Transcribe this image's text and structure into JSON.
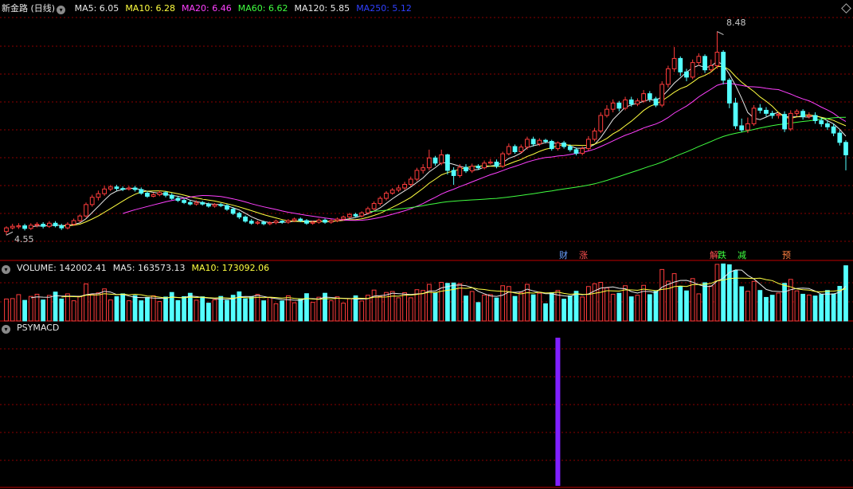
{
  "header": {
    "stock_name": "新金路 (日线)",
    "ma": [
      {
        "label": "MA5: 6.05",
        "color": "#e8e8e8"
      },
      {
        "label": "MA10: 6.28",
        "color": "#ffff40"
      },
      {
        "label": "MA20: 6.46",
        "color": "#ff40ff"
      },
      {
        "label": "MA60: 6.62",
        "color": "#40ff40"
      },
      {
        "label": "MA120: 5.85",
        "color": "#e8e8e8"
      },
      {
        "label": "MA250: 5.12",
        "color": "#3040ff"
      }
    ]
  },
  "volume_header": {
    "volume": "VOLUME: 142002.41",
    "ma5": "MA5: 163573.13",
    "ma10": "MA10: 173092.06"
  },
  "indicator_header": {
    "name": "PSYMACD"
  },
  "price_labels": {
    "high": "8.48",
    "low": "4.55"
  },
  "event_tags": [
    {
      "text": "财",
      "color": "#6aa0ff"
    },
    {
      "text": "涨",
      "color": "#ff5050"
    },
    {
      "text": "解",
      "color": "#ff5050"
    },
    {
      "text": "跌",
      "color": "#40ff40"
    },
    {
      "text": "减",
      "color": "#40ff40"
    },
    {
      "text": "预",
      "color": "#ff8040"
    }
  ],
  "colors": {
    "up": "#ff3c3c",
    "down": "#54ffff",
    "grid": "#8c0000",
    "separator": "#c00000",
    "psymacd": "#8020ff"
  },
  "chart_data": {
    "type": "candlestick",
    "title": "新金路 (日线)",
    "price_high": 8.48,
    "price_low": 4.55,
    "ylim": [
      4.4,
      8.75
    ],
    "candles": [
      [
        4.62,
        4.69,
        4.72,
        4.55
      ],
      [
        4.69,
        4.72,
        4.77,
        4.66
      ],
      [
        4.71,
        4.73,
        4.78,
        4.67
      ],
      [
        4.73,
        4.68,
        4.77,
        4.64
      ],
      [
        4.68,
        4.74,
        4.78,
        4.65
      ],
      [
        4.74,
        4.76,
        4.8,
        4.7
      ],
      [
        4.76,
        4.72,
        4.8,
        4.68
      ],
      [
        4.72,
        4.78,
        4.82,
        4.69
      ],
      [
        4.78,
        4.73,
        4.82,
        4.7
      ],
      [
        4.73,
        4.69,
        4.77,
        4.65
      ],
      [
        4.69,
        4.76,
        4.8,
        4.66
      ],
      [
        4.76,
        4.83,
        4.87,
        4.73
      ],
      [
        4.83,
        4.92,
        4.95,
        4.8
      ],
      [
        4.92,
        5.14,
        5.18,
        4.89
      ],
      [
        5.14,
        5.28,
        5.33,
        5.1
      ],
      [
        5.28,
        5.35,
        5.41,
        5.22
      ],
      [
        5.35,
        5.44,
        5.5,
        5.31
      ],
      [
        5.44,
        5.48,
        5.52,
        5.4
      ],
      [
        5.48,
        5.45,
        5.52,
        5.41
      ],
      [
        5.45,
        5.44,
        5.49,
        5.4
      ],
      [
        5.44,
        5.46,
        5.5,
        5.41
      ],
      [
        5.46,
        5.43,
        5.5,
        5.39
      ],
      [
        5.43,
        5.36,
        5.47,
        5.33
      ],
      [
        5.36,
        5.3,
        5.4,
        5.27
      ],
      [
        5.3,
        5.33,
        5.37,
        5.28
      ],
      [
        5.33,
        5.37,
        5.41,
        5.3
      ],
      [
        5.37,
        5.32,
        5.4,
        5.28
      ],
      [
        5.32,
        5.26,
        5.36,
        5.23
      ],
      [
        5.26,
        5.22,
        5.3,
        5.19
      ],
      [
        5.22,
        5.18,
        5.26,
        5.15
      ],
      [
        5.18,
        5.15,
        5.22,
        5.12
      ],
      [
        5.15,
        5.18,
        5.22,
        5.12
      ],
      [
        5.18,
        5.15,
        5.21,
        5.12
      ],
      [
        5.15,
        5.11,
        5.18,
        5.08
      ],
      [
        5.11,
        5.14,
        5.17,
        5.08
      ],
      [
        5.14,
        5.12,
        5.17,
        5.09
      ],
      [
        5.12,
        5.05,
        5.15,
        5.02
      ],
      [
        5.05,
        4.97,
        5.09,
        4.94
      ],
      [
        4.97,
        4.9,
        5.0,
        4.86
      ],
      [
        4.9,
        4.82,
        4.93,
        4.79
      ],
      [
        4.82,
        4.78,
        4.86,
        4.75
      ],
      [
        4.78,
        4.8,
        4.83,
        4.75
      ],
      [
        4.8,
        4.77,
        4.83,
        4.74
      ],
      [
        4.77,
        4.79,
        4.82,
        4.74
      ],
      [
        4.79,
        4.82,
        4.85,
        4.76
      ],
      [
        4.82,
        4.8,
        4.84,
        4.77
      ],
      [
        4.8,
        4.83,
        4.86,
        4.77
      ],
      [
        4.83,
        4.86,
        4.89,
        4.8
      ],
      [
        4.86,
        4.83,
        4.89,
        4.8
      ],
      [
        4.83,
        4.78,
        4.86,
        4.75
      ],
      [
        4.78,
        4.8,
        4.83,
        4.75
      ],
      [
        4.8,
        4.84,
        4.87,
        4.77
      ],
      [
        4.84,
        4.8,
        4.87,
        4.77
      ],
      [
        4.8,
        4.83,
        4.86,
        4.77
      ],
      [
        4.83,
        4.86,
        4.89,
        4.8
      ],
      [
        4.86,
        4.9,
        4.93,
        4.83
      ],
      [
        4.9,
        4.95,
        4.98,
        4.87
      ],
      [
        4.95,
        4.92,
        4.98,
        4.89
      ],
      [
        4.92,
        4.98,
        5.01,
        4.89
      ],
      [
        4.98,
        5.06,
        5.1,
        4.95
      ],
      [
        5.06,
        5.16,
        5.2,
        5.03
      ],
      [
        5.16,
        5.26,
        5.3,
        5.12
      ],
      [
        5.26,
        5.36,
        5.4,
        5.22
      ],
      [
        5.36,
        5.42,
        5.46,
        5.33
      ],
      [
        5.42,
        5.46,
        5.52,
        5.38
      ],
      [
        5.46,
        5.53,
        5.58,
        5.42
      ],
      [
        5.53,
        5.63,
        5.68,
        5.49
      ],
      [
        5.63,
        5.8,
        5.85,
        5.59
      ],
      [
        5.8,
        5.85,
        5.92,
        5.74
      ],
      [
        5.85,
        6.04,
        6.2,
        5.8
      ],
      [
        6.04,
        5.94,
        6.08,
        5.89
      ],
      [
        5.94,
        6.1,
        6.2,
        5.9
      ],
      [
        6.1,
        5.8,
        6.12,
        5.72
      ],
      [
        5.8,
        5.7,
        5.86,
        5.52
      ],
      [
        5.7,
        5.86,
        5.92,
        5.66
      ],
      [
        5.86,
        5.79,
        5.92,
        5.75
      ],
      [
        5.79,
        5.88,
        5.93,
        5.75
      ],
      [
        5.88,
        5.85,
        5.92,
        5.81
      ],
      [
        5.85,
        5.94,
        5.99,
        5.82
      ],
      [
        5.94,
        5.96,
        6.02,
        5.91
      ],
      [
        5.96,
        5.88,
        6.01,
        5.84
      ],
      [
        5.88,
        6.12,
        6.16,
        5.85
      ],
      [
        6.12,
        6.26,
        6.32,
        6.09
      ],
      [
        6.26,
        6.16,
        6.3,
        6.12
      ],
      [
        6.16,
        6.25,
        6.3,
        6.12
      ],
      [
        6.25,
        6.4,
        6.45,
        6.2
      ],
      [
        6.4,
        6.31,
        6.45,
        6.26
      ],
      [
        6.31,
        6.38,
        6.42,
        6.27
      ],
      [
        6.38,
        6.36,
        6.41,
        6.32
      ],
      [
        6.36,
        6.22,
        6.39,
        6.18
      ],
      [
        6.22,
        6.33,
        6.36,
        6.18
      ],
      [
        6.33,
        6.26,
        6.37,
        6.22
      ],
      [
        6.26,
        6.2,
        6.3,
        6.16
      ],
      [
        6.2,
        6.13,
        6.24,
        6.09
      ],
      [
        6.13,
        6.22,
        6.26,
        6.09
      ],
      [
        6.22,
        6.4,
        6.46,
        6.18
      ],
      [
        6.4,
        6.56,
        6.62,
        6.36
      ],
      [
        6.56,
        6.86,
        6.92,
        6.52
      ],
      [
        6.86,
        6.98,
        7.06,
        6.82
      ],
      [
        6.98,
        7.1,
        7.17,
        6.92
      ],
      [
        7.1,
        7.0,
        7.14,
        6.94
      ],
      [
        7.0,
        7.16,
        7.22,
        6.96
      ],
      [
        7.16,
        7.08,
        7.22,
        7.03
      ],
      [
        7.08,
        7.14,
        7.19,
        7.04
      ],
      [
        7.14,
        7.28,
        7.35,
        7.1
      ],
      [
        7.28,
        7.18,
        7.33,
        7.12
      ],
      [
        7.18,
        7.06,
        7.22,
        7.02
      ],
      [
        7.06,
        7.46,
        7.52,
        7.02
      ],
      [
        7.46,
        7.76,
        7.82,
        7.4
      ],
      [
        7.76,
        7.96,
        8.18,
        7.7
      ],
      [
        7.96,
        7.7,
        8.0,
        7.62
      ],
      [
        7.7,
        7.6,
        7.76,
        7.52
      ],
      [
        7.6,
        7.88,
        7.94,
        7.56
      ],
      [
        7.88,
        8.0,
        8.06,
        7.82
      ],
      [
        8.0,
        7.74,
        8.04,
        7.68
      ],
      [
        7.74,
        7.82,
        7.94,
        7.7
      ],
      [
        7.82,
        8.08,
        8.48,
        7.76
      ],
      [
        8.08,
        7.54,
        8.12,
        7.46
      ],
      [
        7.54,
        7.1,
        7.58,
        7.0
      ],
      [
        7.1,
        6.66,
        7.2,
        6.6
      ],
      [
        6.66,
        6.58,
        6.8,
        6.54
      ],
      [
        6.58,
        6.7,
        6.82,
        6.52
      ],
      [
        6.7,
        7.0,
        7.06,
        6.66
      ],
      [
        7.0,
        6.96,
        7.08,
        6.9
      ],
      [
        6.96,
        6.9,
        7.02,
        6.84
      ],
      [
        6.9,
        6.86,
        6.95,
        6.8
      ],
      [
        6.86,
        6.88,
        6.92,
        6.8
      ],
      [
        6.88,
        6.6,
        6.94,
        6.54
      ],
      [
        6.6,
        6.9,
        6.96,
        6.56
      ],
      [
        6.9,
        6.94,
        6.98,
        6.84
      ],
      [
        6.94,
        6.84,
        6.98,
        6.78
      ],
      [
        6.84,
        6.86,
        6.92,
        6.8
      ],
      [
        6.86,
        6.76,
        6.92,
        6.7
      ],
      [
        6.76,
        6.7,
        6.82,
        6.64
      ],
      [
        6.7,
        6.64,
        6.76,
        6.58
      ],
      [
        6.64,
        6.52,
        6.7,
        6.46
      ],
      [
        6.52,
        6.34,
        6.58,
        6.28
      ],
      [
        6.34,
        6.1,
        6.38,
        5.8
      ]
    ],
    "volume_ylim": [
      0,
      70000000
    ],
    "psymacd_bar": {
      "index": 90,
      "value": 1
    }
  }
}
